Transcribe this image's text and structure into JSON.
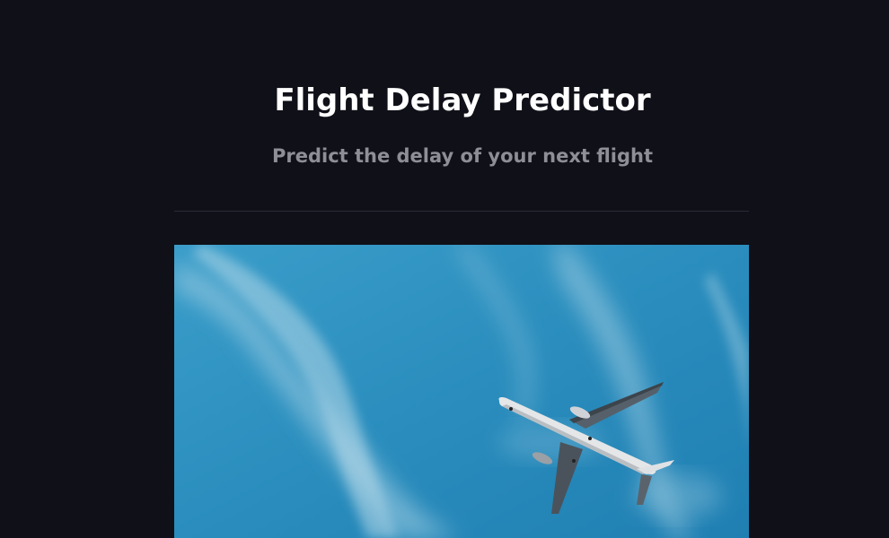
{
  "header": {
    "title": "Flight Delay Predictor",
    "subtitle": "Predict the delay of your next flight"
  },
  "hero": {
    "icon": "airplane-in-sky-photo"
  },
  "colors": {
    "background": "#0f1018",
    "title": "#ffffff",
    "subtitle": "#8e8f96",
    "divider": "#2b2c35",
    "sky": "#2d8fbe"
  }
}
